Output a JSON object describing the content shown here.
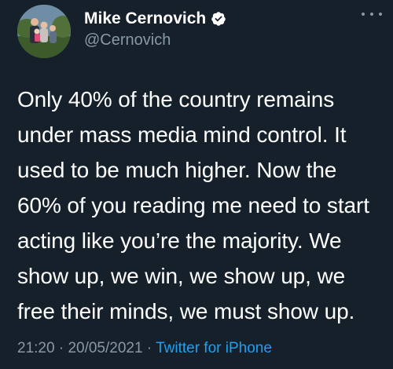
{
  "author": {
    "display_name": "Mike Cernovich",
    "handle": "@Cernovich",
    "verified": true
  },
  "tweet": {
    "lines": [
      "Only 40% of the country remains",
      "under mass media mind control. It",
      "used to be much higher. Now the",
      "60% of you reading me need to start",
      "acting like you’re the majority. We",
      "show up, we win, we show up, we",
      "free their minds, we must show up."
    ],
    "time": "21:20",
    "separator_1": " · ",
    "date": "20/05/2021",
    "separator_2": " · ",
    "source": "Twitter for iPhone"
  },
  "icons": {
    "verified": "verified-badge-icon",
    "more": "more-options-icon"
  },
  "colors": {
    "background": "#15202b",
    "text": "#ffffff",
    "secondary": "#8899a6",
    "accent": "#1da1f2"
  }
}
